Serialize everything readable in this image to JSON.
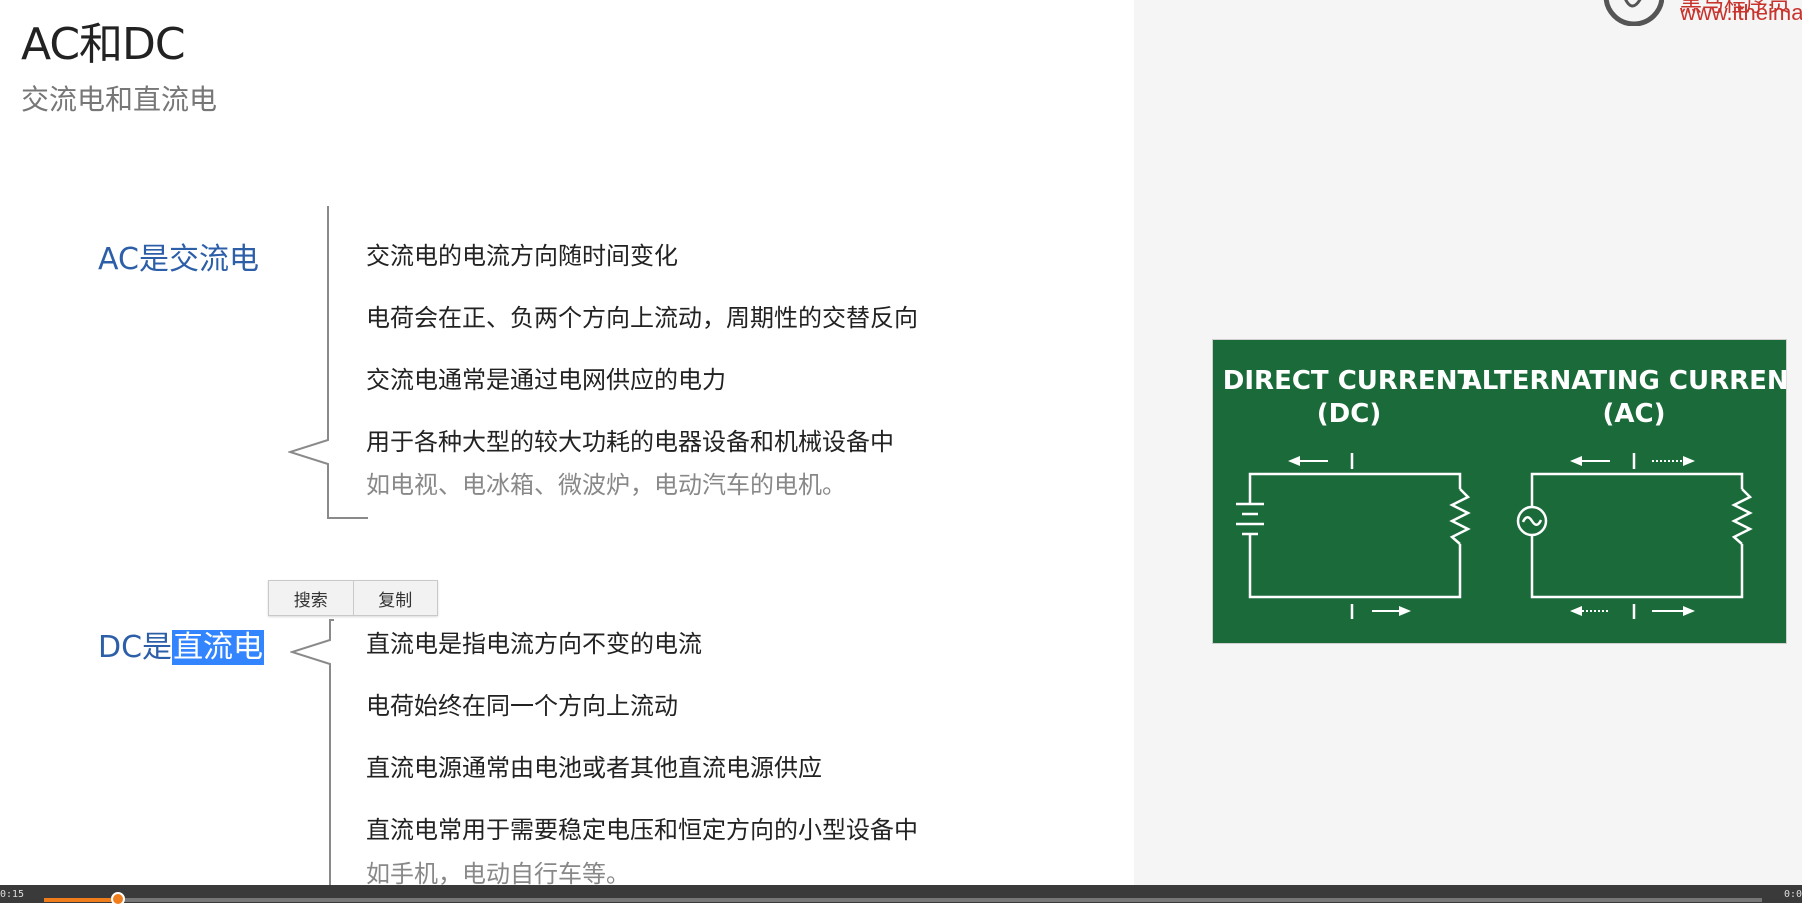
{
  "slide": {
    "title": "AC和DC",
    "subtitle": "交流电和直流电",
    "logo_text": "黑马程序员",
    "logo_url": "www.itheima."
  },
  "ac": {
    "term_prefix": "AC是",
    "term_rest": "交流电",
    "points": [
      "交流电的电流方向随时间变化",
      "电荷会在正、负两个方向上流动，周期性的交替反向",
      "交流电通常是通过电网供应的电力",
      "用于各种大型的较大功耗的电器设备和机械设备中"
    ],
    "example": "如电视、电冰箱、微波炉，电动汽车的电机。"
  },
  "dc": {
    "term_prefix": "DC是",
    "term_selected": "直流电",
    "points": [
      "直流电是指电流方向不变的电流",
      "电荷始终在同一个方向上流动",
      "直流电源通常由电池或者其他直流电源供应",
      "直流电常用于需要稳定电压和恒定方向的小型设备中"
    ],
    "example": "如手机，电动自行车等。"
  },
  "context_menu": {
    "search": "搜索",
    "copy": "复制"
  },
  "diagram": {
    "dc_title_line1": "DIRECT CURRENT",
    "dc_title_line2": "(DC)",
    "ac_title_line1": "ALTERNATING CURRENT",
    "ac_title_line2": "(AC)",
    "bg_color": "#1b6b3a"
  },
  "player": {
    "elapsed": "0:15",
    "total": "0:0",
    "progress": 0.043
  }
}
